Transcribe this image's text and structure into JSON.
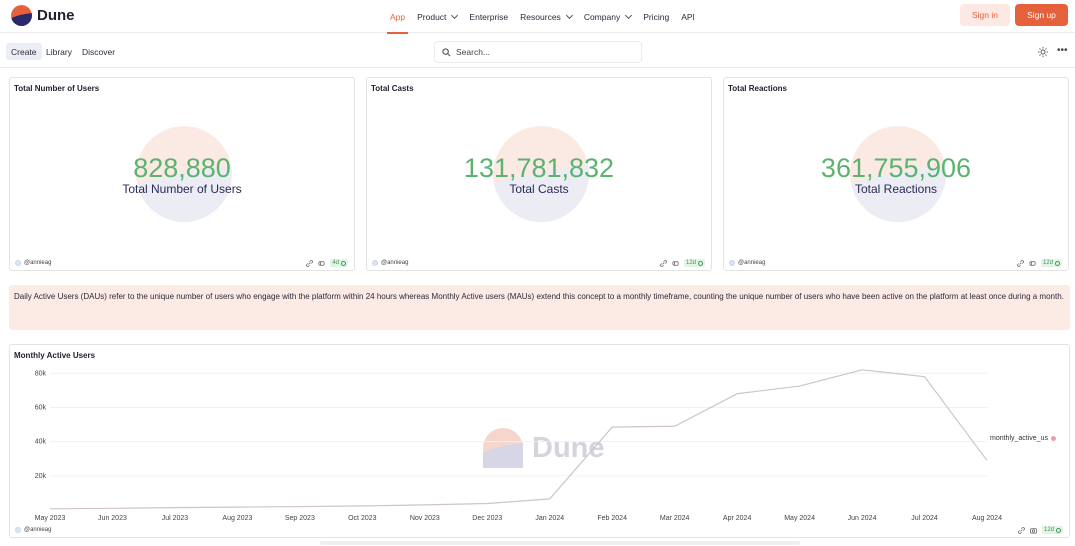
{
  "brand": {
    "name": "Dune",
    "logo_colors": {
      "top": "#e4613b",
      "bottom": "#2a2a6a"
    }
  },
  "nav": {
    "items": [
      {
        "label": "App",
        "active": true,
        "dropdown": false
      },
      {
        "label": "Product",
        "active": false,
        "dropdown": true
      },
      {
        "label": "Enterprise",
        "active": false,
        "dropdown": false
      },
      {
        "label": "Resources",
        "active": false,
        "dropdown": true
      },
      {
        "label": "Company",
        "active": false,
        "dropdown": true
      },
      {
        "label": "Pricing",
        "active": false,
        "dropdown": false
      },
      {
        "label": "API",
        "active": false,
        "dropdown": false
      }
    ],
    "signin_label": "Sign in",
    "signup_label": "Sign up",
    "accent_color": "#e4613b"
  },
  "subnav": {
    "tabs": [
      {
        "label": "Create",
        "active": true
      },
      {
        "label": "Library",
        "active": false
      },
      {
        "label": "Discover",
        "active": false
      }
    ],
    "search_placeholder": "Search...",
    "icons": [
      "search-icon",
      "sun-icon",
      "more-icon"
    ]
  },
  "counters": [
    {
      "title": "Total Number of Users",
      "value": "828,880",
      "label": "Total Number of Users",
      "author": "@annieag",
      "badge": "4d"
    },
    {
      "title": "Total Casts",
      "value": "131,781,832",
      "label": "Total Casts",
      "author": "@annieag",
      "badge": "12d"
    },
    {
      "title": "Total Reactions",
      "value": "361,755,906",
      "label": "Total Reactions",
      "author": "@annieag",
      "badge": "12d"
    }
  ],
  "colors": {
    "counter_value": "#5cb370",
    "counter_label": "#2a2a5a",
    "banner_bg": "#fceae5",
    "line": "#cfc3cc",
    "legend_dot": "#e8a0a8"
  },
  "banner": {
    "text": "Daily Active Users (DAUs) refer to the unique number of users who engage with the platform within 24 hours whereas Monthly Active users (MAUs) extend this concept to a monthly timeframe, counting the unique number of users who have been active on the platform at least once during a month."
  },
  "chart": {
    "title": "Monthly Active Users",
    "author": "@annieag",
    "badge": "12d",
    "watermark": "Dune"
  },
  "chart_data": {
    "type": "line",
    "title": "Monthly Active Users",
    "xlabel": "",
    "ylabel": "",
    "x": [
      "May 2023",
      "Jun 2023",
      "Jul 2023",
      "Aug 2023",
      "Sep 2023",
      "Oct 2023",
      "Nov 2023",
      "Dec 2023",
      "Jan 2024",
      "Feb 2024",
      "Mar 2024",
      "Apr 2024",
      "May 2024",
      "Jun 2024",
      "Jul 2024",
      "Aug 2024"
    ],
    "yticks": [
      20000,
      40000,
      60000,
      80000
    ],
    "ytick_labels": [
      "20k",
      "40k",
      "60k",
      "80k"
    ],
    "ylim": [
      0,
      86000
    ],
    "series": [
      {
        "name": "monthly_active_us",
        "values": [
          700,
          1000,
          1400,
          1700,
          2000,
          2400,
          3000,
          3800,
          6500,
          48500,
          49000,
          68000,
          72500,
          82000,
          78000,
          29000
        ]
      }
    ],
    "grid": true,
    "legend": "right"
  }
}
